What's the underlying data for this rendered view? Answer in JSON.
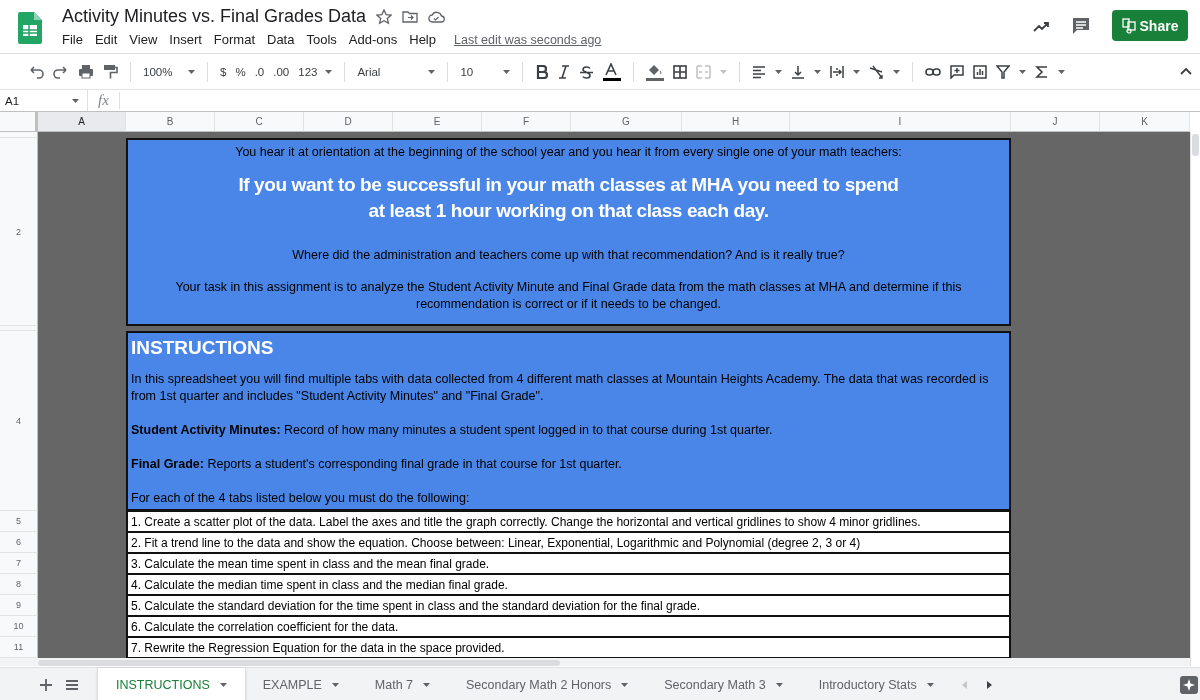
{
  "document": {
    "title": "Activity Minutes vs. Final Grades Data",
    "menus": [
      "File",
      "Edit",
      "View",
      "Insert",
      "Format",
      "Data",
      "Tools",
      "Add-ons",
      "Help"
    ],
    "last_edit": "Last edit was seconds ago"
  },
  "share_button": "Share",
  "toolbar": {
    "zoom": "100%",
    "currency": "$",
    "percent": "%",
    "decrease_decimals": ".0",
    "increase_decimals": ".00",
    "number_format": "123",
    "font": "Arial",
    "font_size": "10"
  },
  "formula_bar": {
    "name_box": "A1",
    "function_label": "fx"
  },
  "grid": {
    "columns": [
      {
        "label": "A",
        "selected": true
      },
      {
        "label": "B",
        "selected": false
      },
      {
        "label": "C",
        "selected": false
      },
      {
        "label": "D",
        "selected": false
      },
      {
        "label": "E",
        "selected": false
      },
      {
        "label": "F",
        "selected": false
      },
      {
        "label": "G",
        "selected": false
      },
      {
        "label": "H",
        "selected": false
      },
      {
        "label": "I",
        "selected": false
      },
      {
        "label": "J",
        "selected": false
      },
      {
        "label": "K",
        "selected": false
      }
    ],
    "row_numbers": [
      "2",
      "4",
      "5",
      "6",
      "7",
      "8",
      "9",
      "10",
      "11"
    ],
    "intro": {
      "lead": "You hear it at orientation at the beginning of the school year and you hear it from every single one of your math teachers:",
      "headline": "If you want to be successful in your math classes at MHA you need to spend at least 1 hour working on that class each day.",
      "question": "Where did the administration and teachers come up with that recommendation? And is it really true?",
      "task": "Your task in this assignment is to analyze the Student Activity Minute and Final Grade data from the math classes at MHA and determine if this recommendation is correct or if it needs to be changed."
    },
    "instructions": {
      "heading": "INSTRUCTIONS",
      "paragraphs": [
        "In this spreadsheet you will find multiple tabs with data collected from 4 different math classes at Mountain Heights Academy. The data that was recorded is from 1st quarter and includes \"Student Activity Minutes\" and \"Final Grade\".",
        "**Student Activity Minutes:** Record of how many minutes a student spent logged in to that course during 1st quarter.",
        "**Final Grade:** Reports a student's corresponding final grade in that course for 1st quarter.",
        "For each of the 4 tabs listed below you must do the following:"
      ]
    },
    "steps": [
      "1. Create a scatter plot of the data. Label the axes and title the graph correctly. Change the horizontal and vertical gridlines to show 4 minor gridlines.",
      "2. Fit a trend line to the data and show the equation. Choose between: Linear, Exponential, Logarithmic and Polynomial (degree 2, 3 or 4)",
      "3. Calculate the mean time spent in class and the mean final grade.",
      "4. Calculate the median time spent in class and the median final grade.",
      "5. Calculate the standard deviation for the time spent in class and the standard deviation for the final grade.",
      "6. Calculate the correlation coefficient for the data.",
      "7. Rewrite the Regression Equation for the data in the space provided."
    ]
  },
  "sheet_tabs": [
    {
      "label": "INSTRUCTIONS",
      "selected": true
    },
    {
      "label": "EXAMPLE",
      "selected": false
    },
    {
      "label": "Math 7",
      "selected": false
    },
    {
      "label": "Secondary Math 2 Honors",
      "selected": false
    },
    {
      "label": "Secondary Math 3",
      "selected": false
    },
    {
      "label": "Introductory Stats",
      "selected": false
    }
  ]
}
